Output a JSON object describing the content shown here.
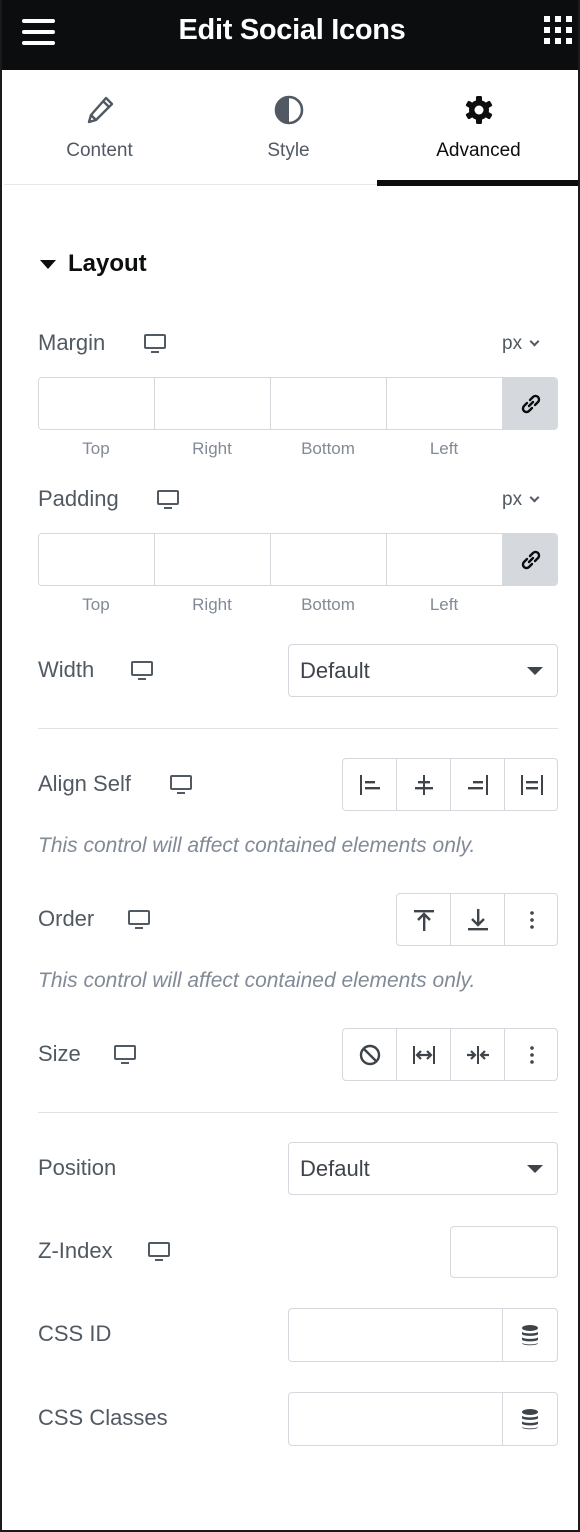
{
  "header": {
    "title": "Edit Social Icons",
    "menu_icon": "hamburger-menu-icon",
    "apps_icon": "apps-grid-icon"
  },
  "tabs": [
    {
      "label": "Content",
      "icon": "pencil-icon",
      "active": false
    },
    {
      "label": "Style",
      "icon": "half-circle-contrast-icon",
      "active": false
    },
    {
      "label": "Advanced",
      "icon": "gear-icon",
      "active": true
    }
  ],
  "section": {
    "title": "Layout",
    "expanded": true
  },
  "margin": {
    "label": "Margin",
    "unit": "px",
    "fields": [
      "Top",
      "Right",
      "Bottom",
      "Left"
    ],
    "values": [
      "",
      "",
      "",
      ""
    ],
    "linked": true
  },
  "padding": {
    "label": "Padding",
    "unit": "px",
    "fields": [
      "Top",
      "Right",
      "Bottom",
      "Left"
    ],
    "values": [
      "",
      "",
      "",
      ""
    ],
    "linked": true
  },
  "width": {
    "label": "Width",
    "value": "Default"
  },
  "align_self": {
    "label": "Align Self",
    "options": [
      "align-start-icon",
      "align-center-icon",
      "align-end-icon",
      "align-stretch-icon"
    ],
    "note": "This control will affect contained elements only."
  },
  "order": {
    "label": "Order",
    "options": [
      "order-first-icon",
      "order-last-icon",
      "more-options-icon"
    ],
    "note": "This control will affect contained elements only."
  },
  "size": {
    "label": "Size",
    "options": [
      "size-none-icon",
      "size-grow-icon",
      "size-shrink-icon",
      "more-options-icon"
    ]
  },
  "position": {
    "label": "Position",
    "value": "Default"
  },
  "z_index": {
    "label": "Z-Index",
    "value": ""
  },
  "css_id": {
    "label": "CSS ID",
    "value": ""
  },
  "css_classes": {
    "label": "CSS Classes",
    "value": ""
  },
  "colors": {
    "header_bg": "#0c0d0e",
    "text": "#515962",
    "muted": "#818a96",
    "border": "#d5d8dc",
    "link_bg": "#d5d8dc"
  }
}
